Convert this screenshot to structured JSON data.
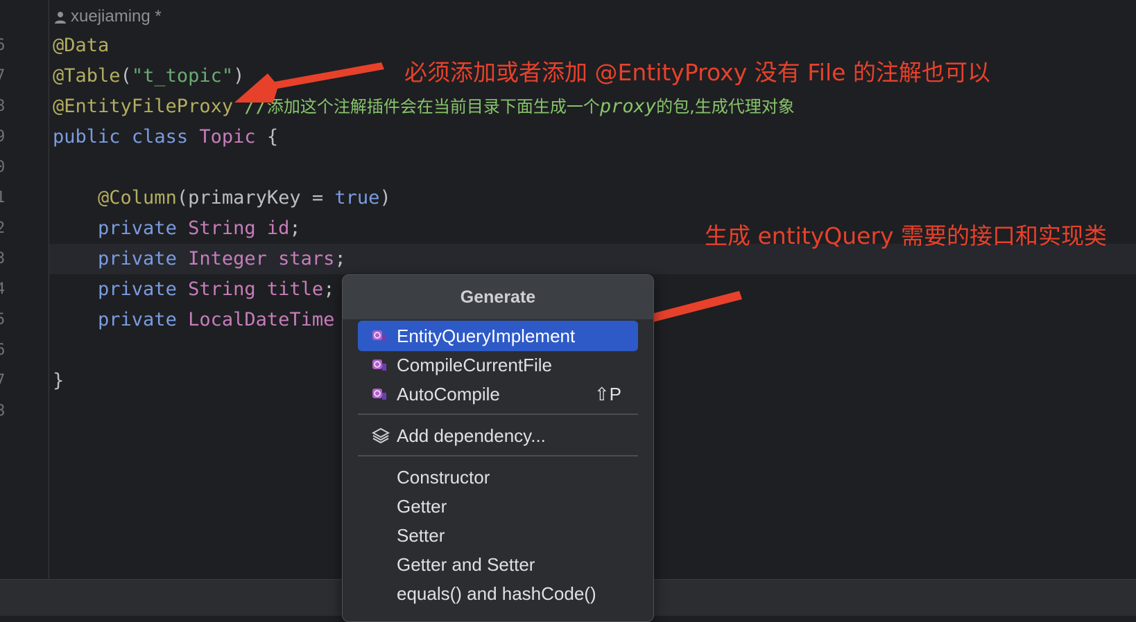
{
  "author_hint": "xuejiaming *",
  "line_numbers": [
    "6",
    "7",
    "8",
    "9",
    "0",
    "1",
    "2",
    "3",
    "4",
    "5",
    "6",
    "7",
    "8"
  ],
  "code": {
    "l1_annotation": "@Data",
    "l2_annotation": "@Table",
    "l2_paren_open": "(",
    "l2_string": "\"t_topic\"",
    "l2_paren_close": ")",
    "l3_annotation": "@EntityFileProxy",
    "l3_comment_prefix": " //",
    "l3_comment_text1": "添加这个注解插件会在当前目录下面生成一个",
    "l3_comment_italic": "proxy",
    "l3_comment_text2": "的包,生成代理对象",
    "l4_public": "public",
    "l4_class": "class",
    "l4_name": "Topic",
    "l4_brace": "{",
    "l6_annotation": "@Column",
    "l6_param": "(primaryKey = ",
    "l6_true": "true",
    "l6_close": ")",
    "l7_private": "private",
    "l7_type": "String",
    "l7_field": "id",
    "l7_semi": ";",
    "l8_private": "private",
    "l8_type": "Integer",
    "l8_field": "stars",
    "l8_semi": ";",
    "l9_private": "private",
    "l9_type": "String",
    "l9_field": "title",
    "l9_semi": ";",
    "l10_private": "private",
    "l10_type": "LocalDateTime",
    "l12_brace": "}"
  },
  "notes": {
    "top": "必须添加或者添加 @EntityProxy 没有 File 的注解也可以",
    "middle": "生成 entityQuery 需要的接口和实现类"
  },
  "popup": {
    "title": "Generate",
    "items": [
      {
        "label": "EntityQueryImplement",
        "icon": "plugin-icon",
        "selected": true
      },
      {
        "label": "CompileCurrentFile",
        "icon": "plugin-icon"
      },
      {
        "label": "AutoCompile",
        "icon": "plugin-icon",
        "shortcut": "⇧P"
      },
      {
        "label": "Add dependency...",
        "icon": "layers-icon"
      },
      {
        "label": "Constructor"
      },
      {
        "label": "Getter"
      },
      {
        "label": "Setter"
      },
      {
        "label": "Getter and Setter"
      },
      {
        "label": "equals() and hashCode()"
      }
    ]
  },
  "colors": {
    "background": "#1e1f22",
    "selection": "#2e5ac8",
    "arrow_red": "#e8412b",
    "annotation": "#b3ae60",
    "keyword": "#cf8e6d"
  }
}
